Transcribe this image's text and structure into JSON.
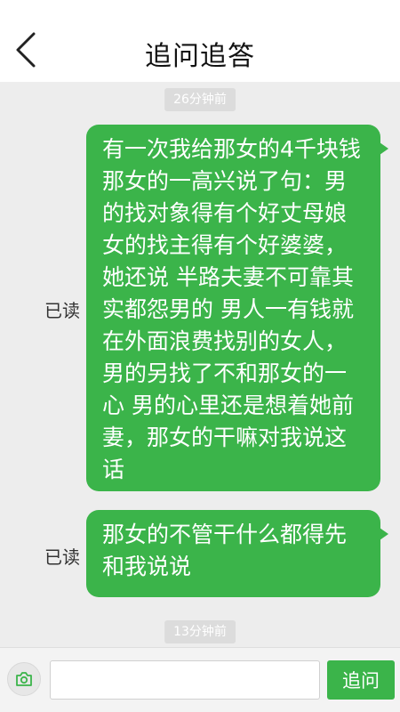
{
  "header": {
    "title": "追问追答"
  },
  "messages": [
    {
      "time": "26分钟前",
      "status": "已读",
      "text": "有一次我给那女的4千块钱那女的一高兴说了句：男的找对象得有个好丈母娘女的找主得有个好婆婆，她还说 半路夫妻不可靠其实都怨男的 男人一有钱就在外面浪费找别的女人，男的另找了不和那女的一心 男的心里还是想着她前妻，那女的干嘛对我说这话"
    },
    {
      "status": "已读",
      "text": "那女的不管干什么都得先和我说说"
    }
  ],
  "last_time": "13分钟前",
  "composer": {
    "placeholder": "",
    "value": "",
    "send_label": "追问"
  },
  "icons": {
    "back": "chevron-left-icon",
    "camera": "camera-icon"
  },
  "colors": {
    "accent": "#3bb44a",
    "background": "#ededed"
  }
}
